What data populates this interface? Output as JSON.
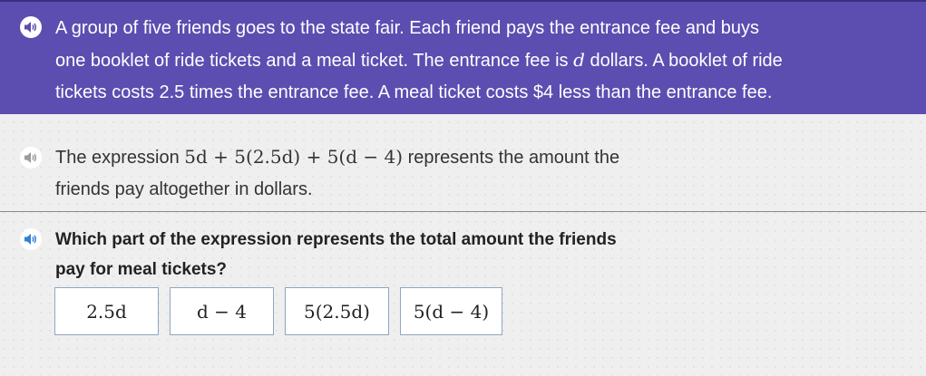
{
  "colors": {
    "banner_bg": "#5c4db1",
    "page_bg": "#efefef",
    "choice_border": "#8fa6c3",
    "audio_blue": "#2f7fd8"
  },
  "problem": {
    "line1": "A group of five friends goes to the state fair. Each friend pays the entrance fee and buys",
    "line2_a": "one booklet of ride tickets and a meal ticket. The entrance fee is ",
    "line2_var": "d",
    "line2_b": " dollars. A booklet of ride",
    "line3": "tickets costs 2.5 times the entrance fee. A meal ticket costs $4 less than the entrance fee."
  },
  "statement": {
    "prefix": "The expression ",
    "expression": "5d + 5(2.5d) + 5(d − 4)",
    "suffix": " represents the amount the",
    "line2": "friends pay altogether in dollars."
  },
  "question": {
    "line1": "Which part of the expression represents the total amount the friends",
    "line2": "pay for meal tickets?"
  },
  "choices": [
    {
      "label": "2.5d"
    },
    {
      "label": "d − 4"
    },
    {
      "label": "5(2.5d)"
    },
    {
      "label": "5(d − 4)"
    }
  ],
  "icons": {
    "audio": "speaker-icon"
  }
}
